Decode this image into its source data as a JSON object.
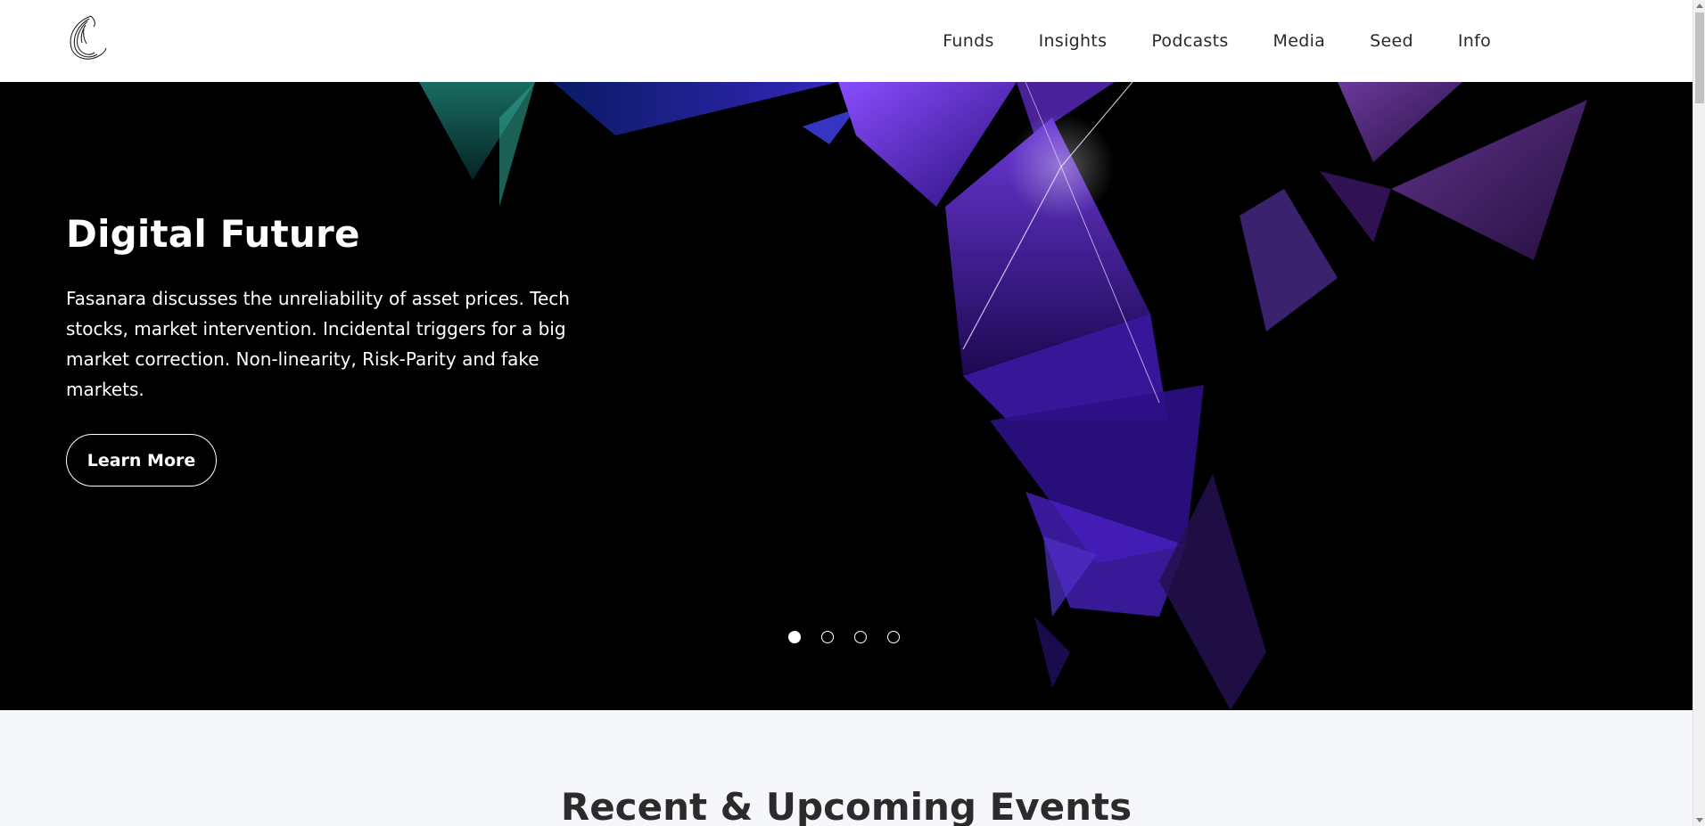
{
  "header": {
    "logo_icon": "feather-swirl-logo",
    "nav": [
      {
        "label": "Funds"
      },
      {
        "label": "Insights"
      },
      {
        "label": "Podcasts"
      },
      {
        "label": "Media"
      },
      {
        "label": "Seed"
      },
      {
        "label": "Info"
      }
    ]
  },
  "hero": {
    "title": "Digital Future",
    "text": "Fasanara discusses the unreliability of asset prices. Tech stocks, market intervention. Incidental triggers for a big market correction. Non-linearity, Risk-Parity and fake markets.",
    "button_label": "Learn More",
    "slides_total": 4,
    "active_slide": 1,
    "colors": {
      "background": "#000000",
      "accent_purple": "#7b3fe0",
      "accent_teal": "#1f8f7a"
    }
  },
  "events": {
    "title": "Recent & Upcoming Events"
  }
}
